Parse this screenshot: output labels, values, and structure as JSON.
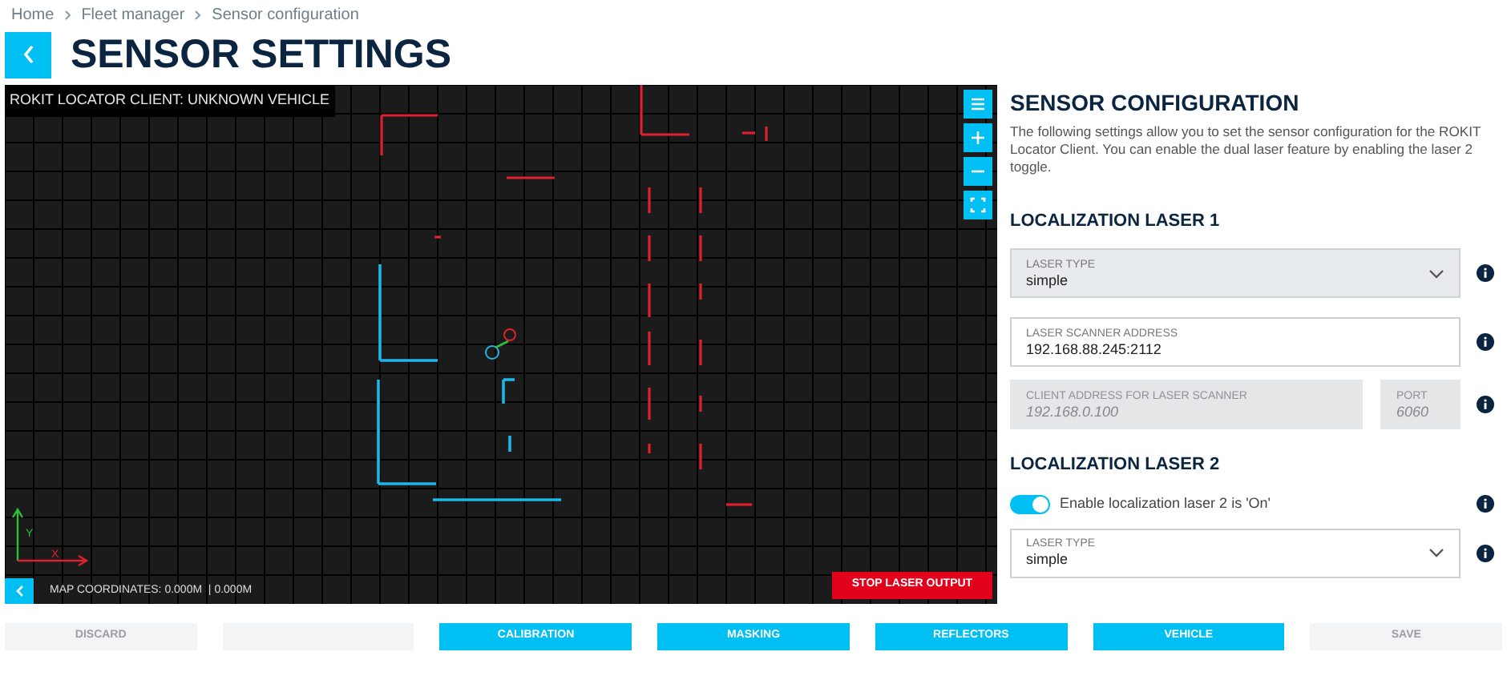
{
  "breadcrumb": [
    "Home",
    "Fleet manager",
    "Sensor configuration"
  ],
  "page_title": "SENSOR SETTINGS",
  "map": {
    "title": "ROKIT LOCATOR CLIENT:  UNKNOWN VEHICLE",
    "coordinates": "MAP COORDINATES: 0.000M  | 0.000M",
    "axis_x": "X",
    "axis_y": "Y",
    "stop_button": "STOP LASER OUTPUT"
  },
  "panel": {
    "title": "SENSOR CONFIGURATION",
    "description": "The following settings allow you to set the sensor configuration for the ROKIT Locator Client. You can enable the dual laser feature by enabling the laser 2 toggle.",
    "laser1": {
      "title": "LOCALIZATION LASER 1",
      "laser_type": {
        "label": "LASER TYPE",
        "value": "simple"
      },
      "scanner_address": {
        "label": "LASER SCANNER ADDRESS",
        "value": "192.168.88.245:2112"
      },
      "client_address": {
        "label": "CLIENT ADDRESS FOR LASER SCANNER",
        "placeholder": "192.168.0.100",
        "disabled": true
      },
      "port": {
        "label": "PORT",
        "placeholder": "6060",
        "disabled": true
      }
    },
    "laser2": {
      "title": "LOCALIZATION LASER 2",
      "toggle": {
        "label": "Enable localization laser 2 is 'On'",
        "on": true
      },
      "laser_type": {
        "label": "LASER TYPE",
        "value": "simple"
      }
    }
  },
  "buttons": [
    {
      "label": "DISCARD",
      "disabled": true
    },
    {
      "disabled": true
    },
    {
      "label": "CALIBRATION",
      "disabled": false
    },
    {
      "label": "MASKING",
      "disabled": false
    },
    {
      "label": "REFLECTORS",
      "disabled": false
    },
    {
      "label": "VEHICLE",
      "disabled": false
    },
    {
      "label": "SAVE",
      "disabled": true
    }
  ]
}
